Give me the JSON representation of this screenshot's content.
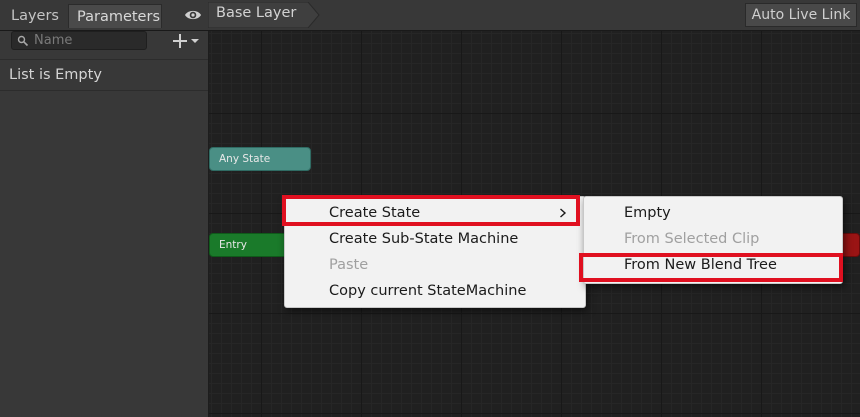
{
  "tabs": {
    "layers": "Layers",
    "parameters": "Parameters"
  },
  "breadcrumb": {
    "base_layer": "Base Layer"
  },
  "toolbar": {
    "auto_live_link": "Auto Live Link"
  },
  "parameters_panel": {
    "search_placeholder": "Name",
    "empty_text": "List is Empty"
  },
  "graph": {
    "nodes": {
      "any_state": "Any State",
      "entry": "Entry"
    }
  },
  "context_menu": {
    "items": [
      {
        "label": "Create State",
        "enabled": true,
        "has_submenu": true
      },
      {
        "label": "Create Sub-State Machine",
        "enabled": true
      },
      {
        "label": "Paste",
        "enabled": false
      },
      {
        "label": "Copy current StateMachine",
        "enabled": true
      }
    ]
  },
  "submenu": {
    "items": [
      {
        "label": "Empty",
        "enabled": true
      },
      {
        "label": "From Selected Clip",
        "enabled": false
      },
      {
        "label": "From New Blend Tree",
        "enabled": true
      }
    ]
  },
  "colors": {
    "highlight": "#e01020",
    "any_state": "#4a8f85",
    "entry": "#1a7a2a",
    "exit": "#9a1414"
  }
}
